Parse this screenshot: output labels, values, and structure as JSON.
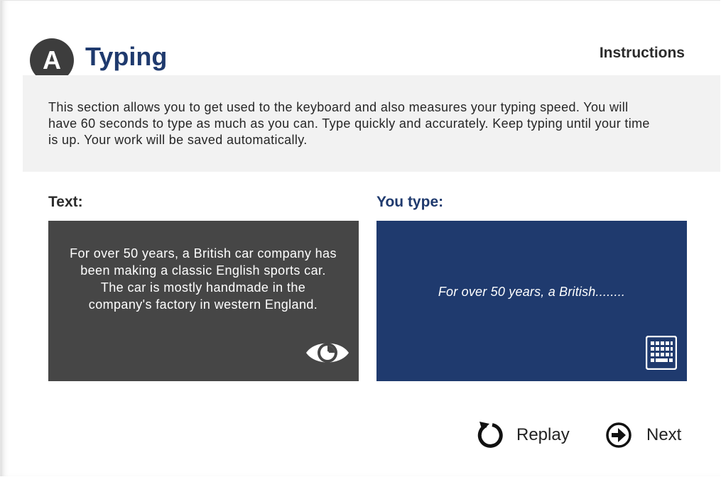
{
  "header": {
    "badge_letter": "A",
    "title": "Typing",
    "instructions_label": "Instructions"
  },
  "instructions": {
    "text": "This section allows you to get used to the keyboard and also measures your typing speed. You will have 60 seconds to type as much as you can. Type quickly and accurately. Keep typing until your time is up. Your work will be saved automatically."
  },
  "source": {
    "label": "Text:",
    "passage": "For over 50 years, a British car company has been making a classic English sports car. The car is mostly handmade in the company's factory in western England.",
    "icon": "eye-icon"
  },
  "typing": {
    "label": "You type:",
    "typed": "For over 50 years, a British........",
    "icon": "keyboard-icon"
  },
  "controls": {
    "replay_label": "Replay",
    "next_label": "Next"
  },
  "colors": {
    "accent": "#1f3a6e",
    "badge": "#3d3d3d",
    "source_panel": "#464646",
    "instructions_panel": "#f2f2f2"
  }
}
